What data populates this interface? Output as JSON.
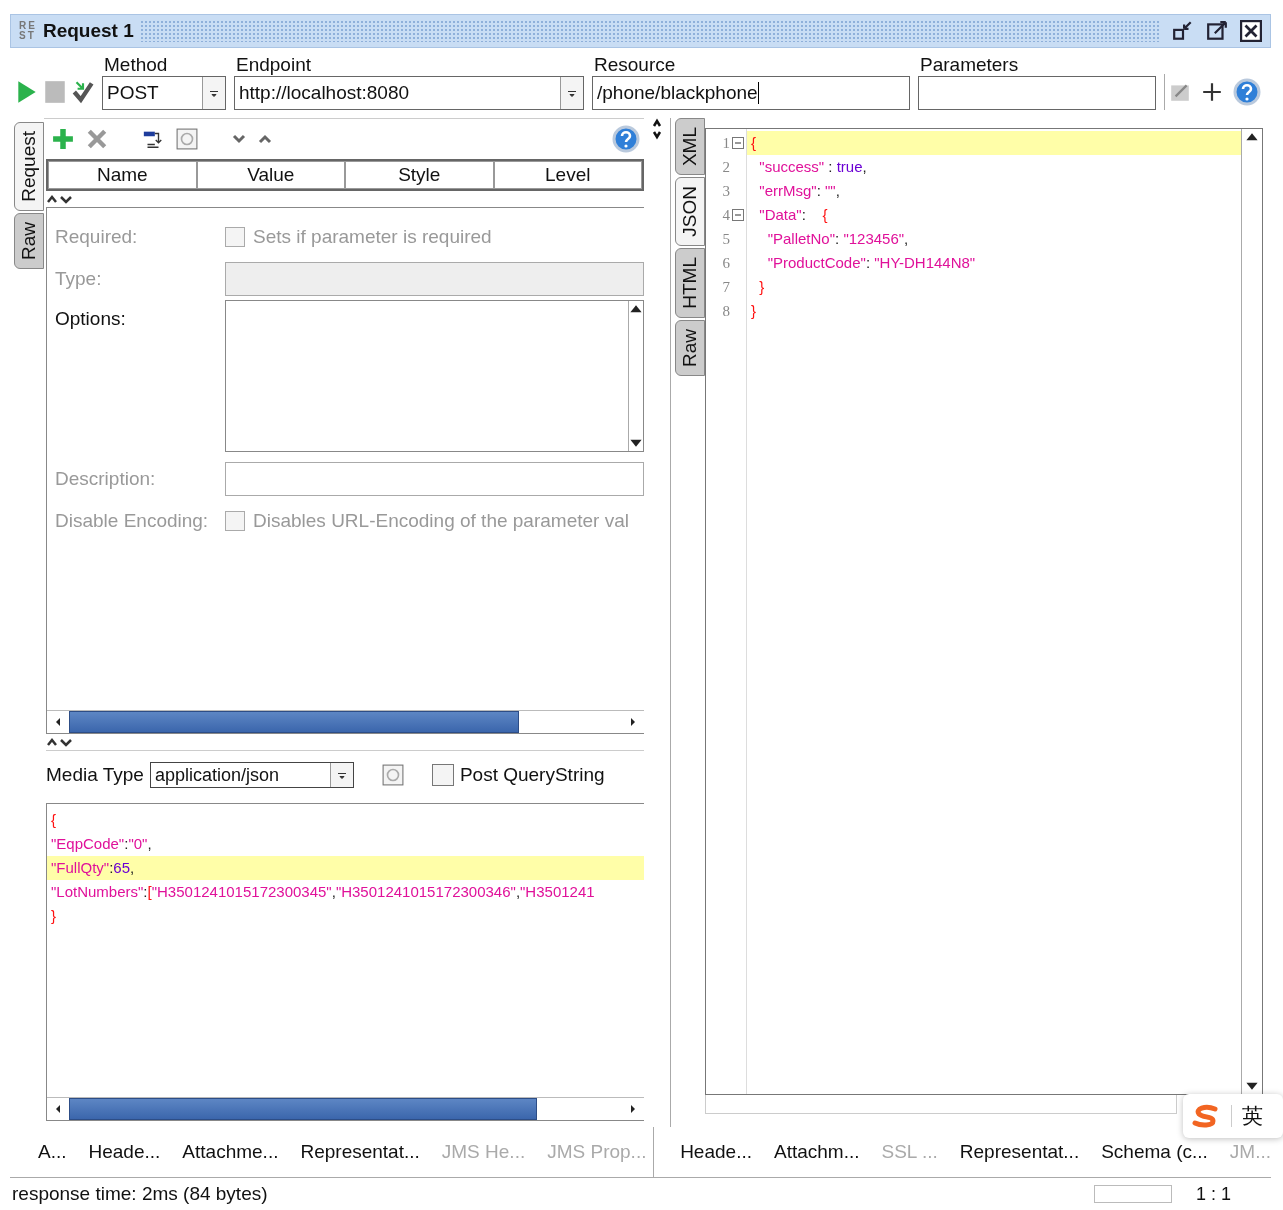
{
  "window": {
    "title": "Request 1",
    "logo": [
      "RE",
      "ST"
    ]
  },
  "toolbar": {
    "method": {
      "label": "Method",
      "value": "POST"
    },
    "endpoint": {
      "label": "Endpoint",
      "value": "http://localhost:8080"
    },
    "resource": {
      "label": "Resource",
      "value": "/phone/blackphone"
    },
    "parameters": {
      "label": "Parameters"
    }
  },
  "request_tabs": [
    {
      "label": "Request",
      "selected": true
    },
    {
      "label": "Raw",
      "selected": false
    }
  ],
  "params_table": {
    "columns": [
      "Name",
      "Value",
      "Style",
      "Level"
    ]
  },
  "param_form": [
    {
      "kind": "checkbox",
      "label": "Required:",
      "text": "Sets if parameter is required",
      "checked": false,
      "disabled": true
    },
    {
      "kind": "field",
      "label": "Type:",
      "disabled": true
    },
    {
      "kind": "list",
      "label": "Options:",
      "disabled": false
    },
    {
      "kind": "field",
      "label": "Description:",
      "disabled": true
    },
    {
      "kind": "checkbox",
      "label": "Disable Encoding:",
      "text": "Disables URL-Encoding of the parameter val",
      "checked": false,
      "disabled": true
    }
  ],
  "media": {
    "label": "Media Type",
    "value": "application/json",
    "post_querystring": {
      "label": "Post QueryString",
      "checked": false
    }
  },
  "request_body": [
    {
      "highlighted": false,
      "tokens": [
        {
          "kind": "bracket",
          "text": "{"
        }
      ]
    },
    {
      "highlighted": false,
      "tokens": [
        {
          "kind": "key",
          "text": "\"EqpCode\""
        },
        {
          "kind": "punct",
          "text": ":"
        },
        {
          "kind": "key",
          "text": "\"0\""
        },
        {
          "kind": "punct",
          "text": ","
        }
      ]
    },
    {
      "highlighted": true,
      "tokens": [
        {
          "kind": "key",
          "text": "\"FullQty\""
        },
        {
          "kind": "punct",
          "text": ":"
        },
        {
          "kind": "literal",
          "text": "65"
        },
        {
          "kind": "punct",
          "text": ","
        }
      ]
    },
    {
      "highlighted": false,
      "tokens": [
        {
          "kind": "key",
          "text": "\"LotNumbers\""
        },
        {
          "kind": "punct",
          "text": ":"
        },
        {
          "kind": "bracket",
          "text": "["
        },
        {
          "kind": "key",
          "text": "\"H3501241015172300345\""
        },
        {
          "kind": "punct",
          "text": ","
        },
        {
          "kind": "key",
          "text": "\"H3501241015172300346\""
        },
        {
          "kind": "punct",
          "text": ","
        },
        {
          "kind": "key",
          "text": "\"H3501241"
        }
      ]
    },
    {
      "highlighted": false,
      "tokens": [
        {
          "kind": "bracket",
          "text": "}"
        }
      ]
    }
  ],
  "response_tabs": [
    {
      "label": "XML",
      "selected": false
    },
    {
      "label": "JSON",
      "selected": true
    },
    {
      "label": "HTML",
      "selected": false
    },
    {
      "label": "Raw",
      "selected": false
    }
  ],
  "response_body": [
    {
      "number": "1",
      "foldable": true,
      "highlighted": true,
      "tokens": [
        {
          "kind": "bracket",
          "text": "{"
        }
      ]
    },
    {
      "number": "2",
      "foldable": false,
      "highlighted": false,
      "tokens": [
        {
          "kind": "key",
          "text": "  \"success\""
        },
        {
          "kind": "punct",
          "text": " : "
        },
        {
          "kind": "literal",
          "text": "true"
        },
        {
          "kind": "punct",
          "text": ","
        }
      ]
    },
    {
      "number": "3",
      "foldable": false,
      "highlighted": false,
      "tokens": [
        {
          "kind": "key",
          "text": "  \"errMsg\""
        },
        {
          "kind": "punct",
          "text": ": "
        },
        {
          "kind": "key",
          "text": "\"\""
        },
        {
          "kind": "punct",
          "text": ","
        }
      ]
    },
    {
      "number": "4",
      "foldable": true,
      "highlighted": false,
      "tokens": [
        {
          "kind": "key",
          "text": "  \"Data\""
        },
        {
          "kind": "punct",
          "text": ":    "
        },
        {
          "kind": "bracket",
          "text": "{"
        }
      ]
    },
    {
      "number": "5",
      "foldable": false,
      "highlighted": false,
      "tokens": [
        {
          "kind": "key",
          "text": "    \"PalletNo\""
        },
        {
          "kind": "punct",
          "text": ": "
        },
        {
          "kind": "key",
          "text": "\"123456\""
        },
        {
          "kind": "punct",
          "text": ","
        }
      ]
    },
    {
      "number": "6",
      "foldable": false,
      "highlighted": false,
      "tokens": [
        {
          "kind": "key",
          "text": "    \"ProductCode\""
        },
        {
          "kind": "punct",
          "text": ": "
        },
        {
          "kind": "key",
          "text": "\"HY-DH144N8\""
        }
      ]
    },
    {
      "number": "7",
      "foldable": false,
      "highlighted": false,
      "tokens": [
        {
          "kind": "bracket",
          "text": "  }"
        }
      ]
    },
    {
      "number": "8",
      "foldable": false,
      "highlighted": false,
      "tokens": [
        {
          "kind": "bracket",
          "text": "}"
        }
      ]
    }
  ],
  "request_bottom_tabs": [
    {
      "label": "A...",
      "disabled": false
    },
    {
      "label": "Heade...",
      "disabled": false
    },
    {
      "label": "Attachme...",
      "disabled": false
    },
    {
      "label": "Representat...",
      "disabled": false
    },
    {
      "label": "JMS He...",
      "disabled": true
    },
    {
      "label": "JMS Prop...",
      "disabled": true
    }
  ],
  "response_bottom_tabs": [
    {
      "label": "Heade...",
      "disabled": false
    },
    {
      "label": "Attachm...",
      "disabled": false
    },
    {
      "label": "SSL ...",
      "disabled": true
    },
    {
      "label": "Representat...",
      "disabled": false
    },
    {
      "label": "Schema (c...",
      "disabled": false
    },
    {
      "label": "JM...",
      "disabled": true
    }
  ],
  "status_bar": {
    "message": "response time: 2ms (84 bytes)",
    "position": "1 : 1"
  },
  "ime": {
    "label": "英"
  }
}
